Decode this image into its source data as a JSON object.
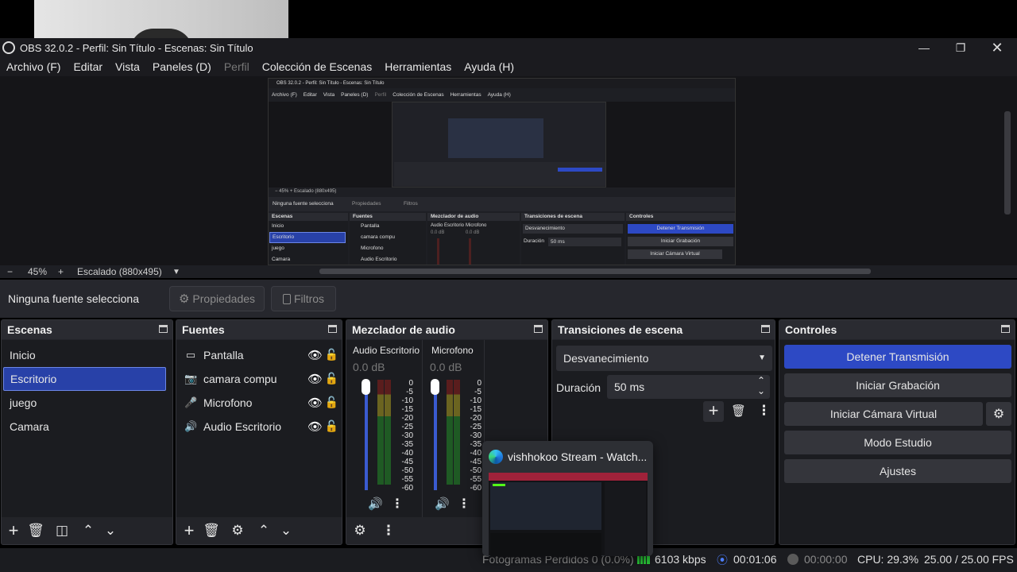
{
  "window": {
    "title": "OBS 32.0.2 - Perfil: Sin Título - Escenas: Sin Título"
  },
  "menu": [
    "Archivo (F)",
    "Editar",
    "Vista",
    "Paneles (D)",
    "Perfil",
    "Colección de Escenas",
    "Herramientas",
    "Ayuda (H)"
  ],
  "zoom": {
    "minus": "−",
    "percent": "45%",
    "plus": "+",
    "scaling": "Escalado (880x495)"
  },
  "source_bar": {
    "label": "Ninguna fuente selecciona",
    "properties": "Propiedades",
    "filters": "Filtros"
  },
  "scenes": {
    "title": "Escenas",
    "items": [
      "Inicio",
      "Escritorio",
      "juego",
      "Camara"
    ],
    "selected_index": 1
  },
  "sources": {
    "title": "Fuentes",
    "items": [
      {
        "name": "Pantalla",
        "icon": "monitor-icon"
      },
      {
        "name": "camara compu",
        "icon": "camera-icon"
      },
      {
        "name": "Microfono",
        "icon": "microphone-icon"
      },
      {
        "name": "Audio Escritorio",
        "icon": "speaker-icon"
      }
    ]
  },
  "mixer": {
    "title": "Mezclador de audio",
    "channels": [
      {
        "name": "Audio Escritorio",
        "db": "0.0 dB"
      },
      {
        "name": "Microfono",
        "db": "0.0 dB"
      }
    ],
    "scale": [
      "0",
      "-5",
      "-10",
      "-15",
      "-20",
      "-25",
      "-30",
      "-35",
      "-40",
      "-45",
      "-50",
      "-55",
      "-60"
    ]
  },
  "transitions": {
    "title": "Transiciones de escena",
    "selected": "Desvanecimiento",
    "duration_label": "Duración",
    "duration_value": "50 ms"
  },
  "controls": {
    "title": "Controles",
    "buttons": [
      "Detener Transmisión",
      "Iniciar Grabación",
      "Iniciar Cámara Virtual",
      "Modo Estudio",
      "Ajustes"
    ]
  },
  "popup": {
    "title": "vishhokoo Stream - Watch..."
  },
  "status": {
    "dropped": "Fotogramas Perdidos 0 (0.0%)",
    "bitrate": "6103 kbps",
    "stream_time": "00:01:06",
    "rec_time": "00:00:00",
    "cpu": "CPU: 29.3%",
    "fps": "25.00 / 25.00 FPS"
  },
  "mini": {
    "title": "OBS 32.0.2 - Perfil: Sin Título - Escenas: Sin Título",
    "menu": [
      "Archivo (F)",
      "Editar",
      "Vista",
      "Paneles (D)",
      "Perfil",
      "Colección de Escenas",
      "Herramientas",
      "Ayuda (H)"
    ],
    "zoom": "45%",
    "scaling": "Escalado (880x495)",
    "source_label": "Ninguna fuente selecciona",
    "properties": "Propiedades",
    "filters": "Filtros",
    "scenes_title": "Escenas",
    "scenes": [
      "Inicio",
      "Escritorio",
      "juego",
      "Camara"
    ],
    "sources_title": "Fuentes",
    "sources": [
      "Pantalla",
      "camara compu",
      "Microfono",
      "Audio Escritorio"
    ],
    "mixer_title": "Mezclador de audio",
    "mixer_channels": [
      "Audio Escritorio",
      "Microfono"
    ],
    "mixer_db": "0.0 dB",
    "trans_title": "Transiciones de escena",
    "trans_selected": "Desvanecimiento",
    "trans_duration": "Duración",
    "trans_ms": "50 ms",
    "controls_title": "Controles",
    "controls": [
      "Detener Transmisión",
      "Iniciar Grabación",
      "Iniciar Cámara Virtual"
    ]
  }
}
